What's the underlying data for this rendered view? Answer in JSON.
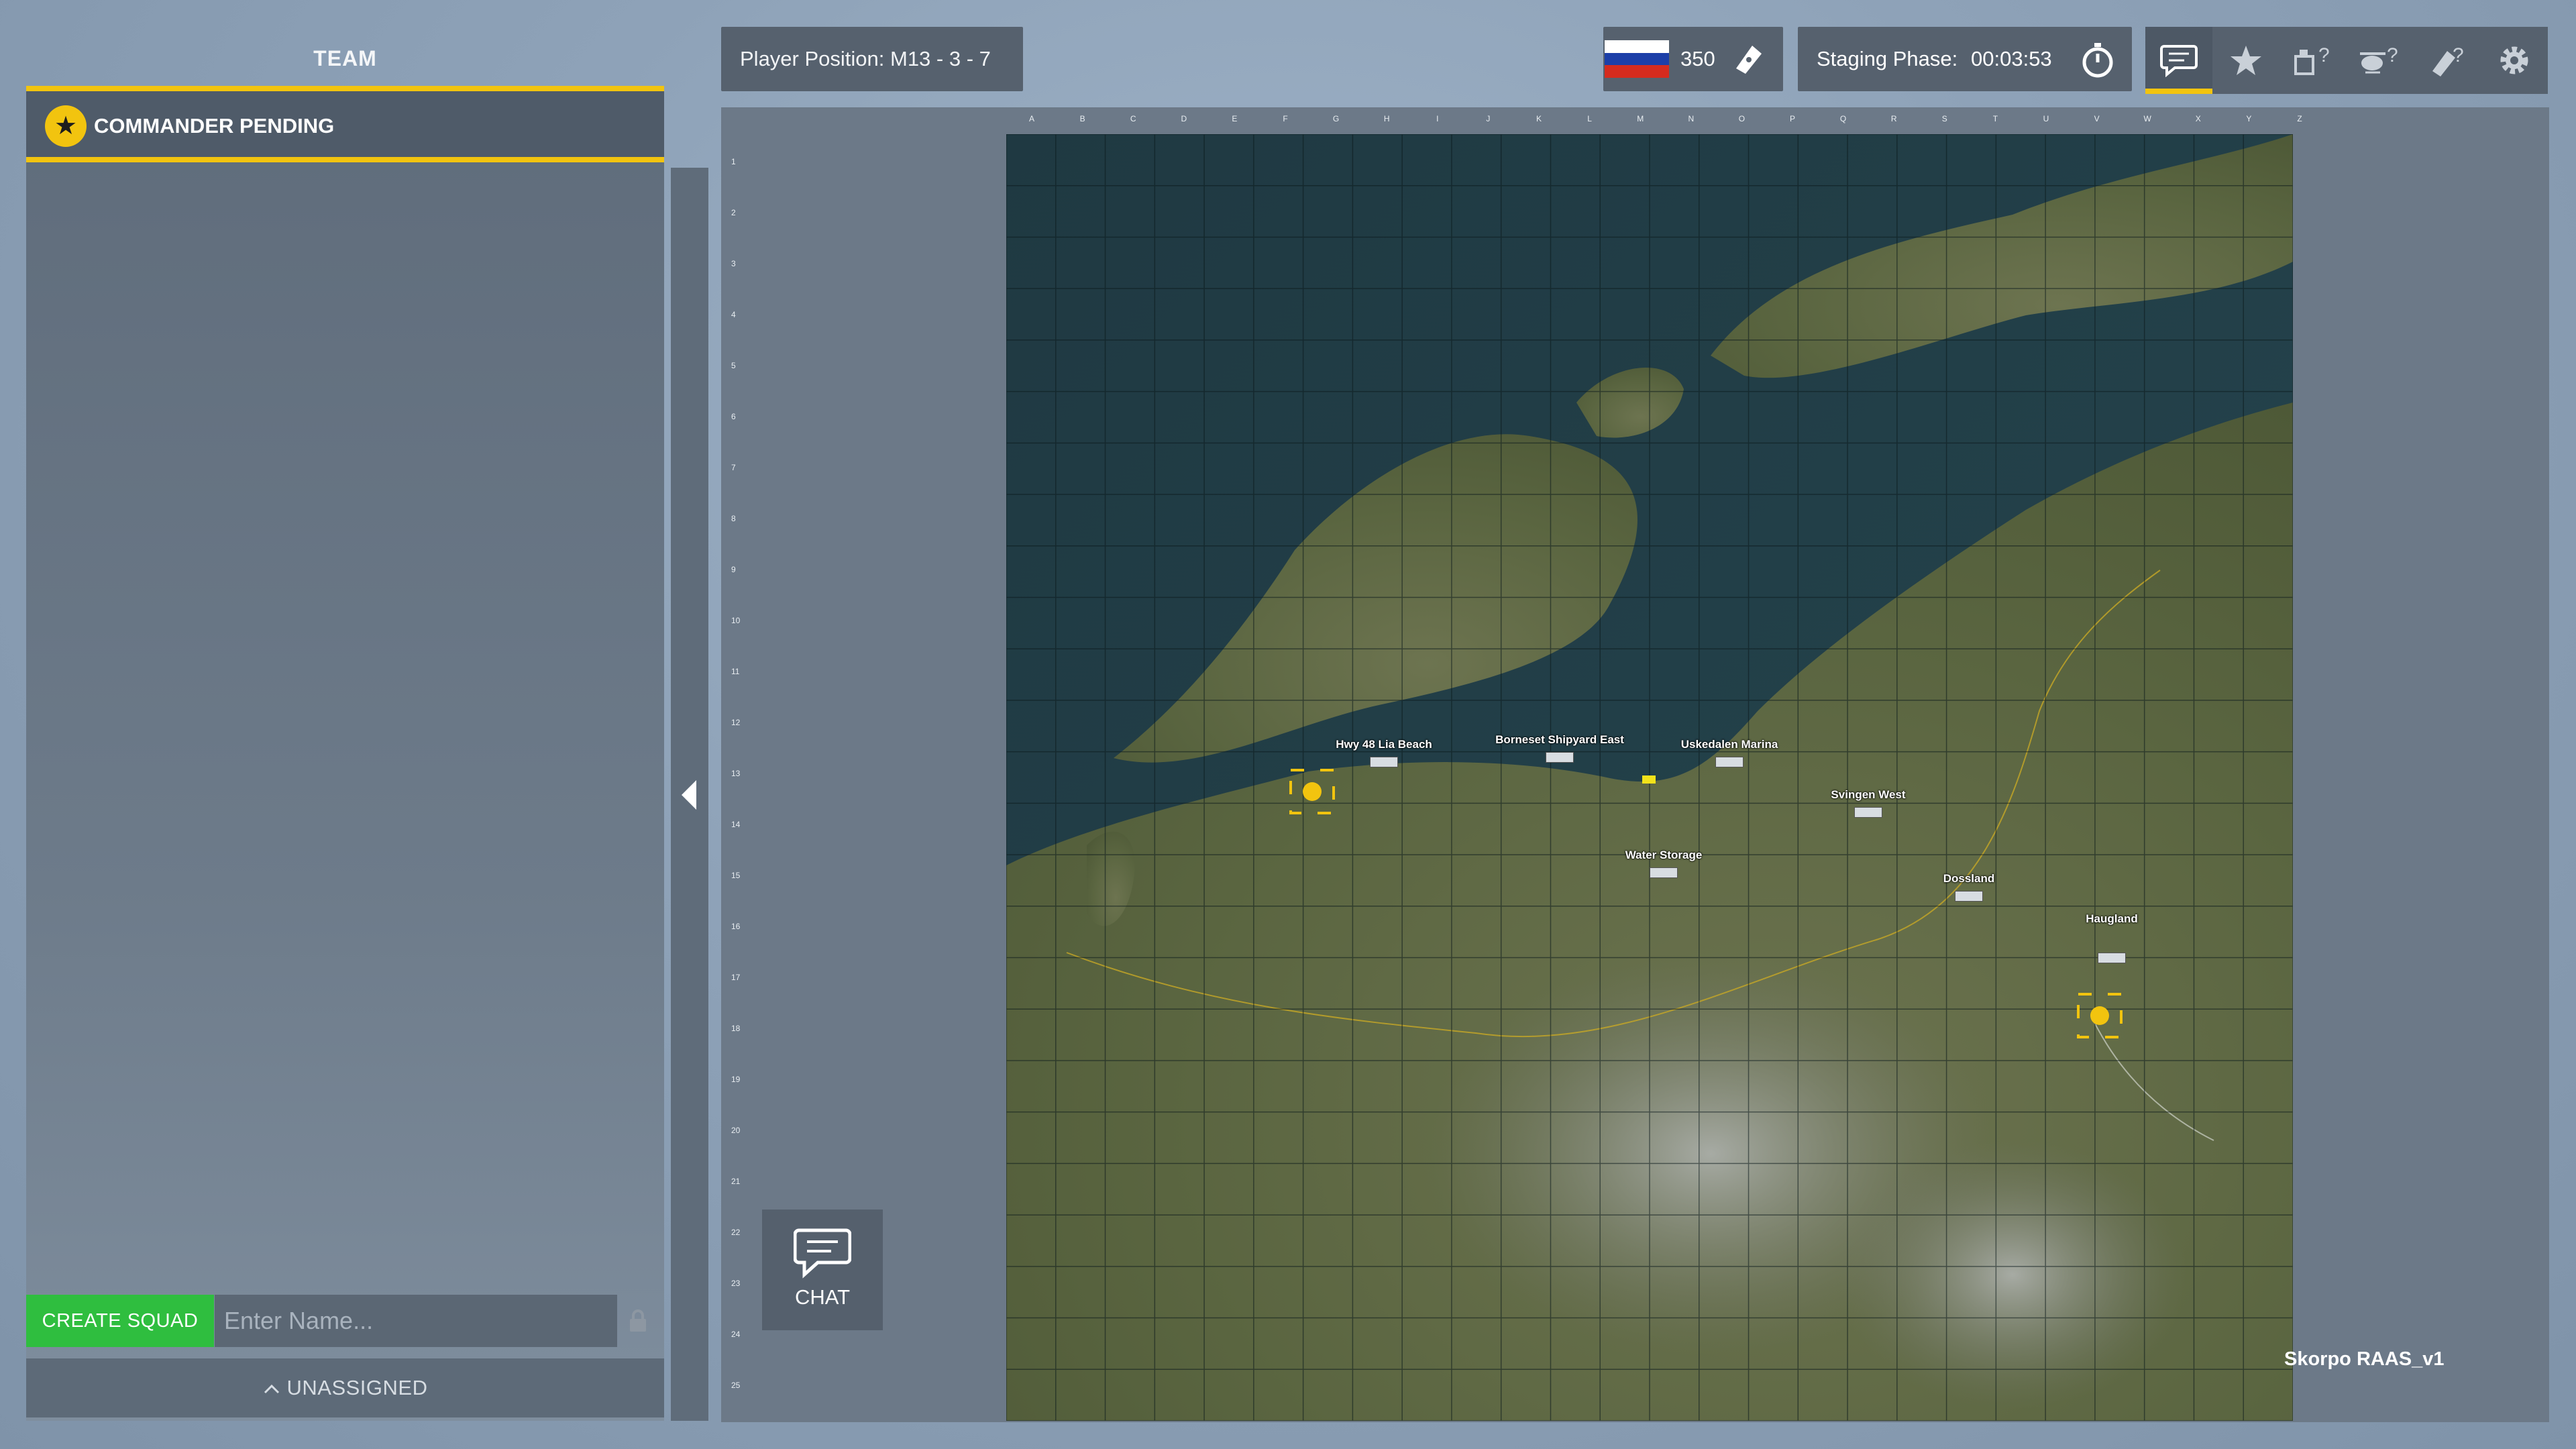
{
  "team_panel": {
    "title": "TEAM",
    "commander_label": "COMMANDER PENDING",
    "create_squad_label": "CREATE SQUAD",
    "squad_name_placeholder": "Enter Name...",
    "unassigned_label": "UNASSIGNED"
  },
  "top_bar": {
    "player_position": "Player Position: M13 - 3 - 7",
    "tickets": "350",
    "staging_label": "Staging Phase:",
    "staging_time": "00:03:53",
    "faction_flag": "russia-flag",
    "tools": [
      {
        "name": "chat-toggle-icon",
        "active": true
      },
      {
        "name": "star-icon",
        "active": false
      },
      {
        "name": "vehicle-help-icon",
        "active": false
      },
      {
        "name": "helicopter-help-icon",
        "active": false
      },
      {
        "name": "deploy-help-icon",
        "active": false
      },
      {
        "name": "settings-gear-icon",
        "active": false
      }
    ]
  },
  "map": {
    "name": "Skorpo RAAS_v1",
    "columns": [
      "A",
      "B",
      "C",
      "D",
      "E",
      "F",
      "G",
      "H",
      "I",
      "J",
      "K",
      "L",
      "M",
      "N",
      "O",
      "P",
      "Q",
      "R",
      "S",
      "T",
      "U",
      "V",
      "W",
      "X",
      "Y",
      "Z"
    ],
    "rows": [
      "1",
      "2",
      "3",
      "4",
      "5",
      "6",
      "7",
      "8",
      "9",
      "10",
      "11",
      "12",
      "13",
      "14",
      "15",
      "16",
      "17",
      "18",
      "19",
      "20",
      "21",
      "22",
      "23",
      "24",
      "25"
    ],
    "locations": [
      "Hwy 48 Lia Beach",
      "Borneset Shipyard East",
      "Uskedalen Marina",
      "Svingen West",
      "Water Storage",
      "Dossland",
      "Haugland"
    ]
  },
  "chat": {
    "label": "CHAT"
  },
  "colors": {
    "accent": "#f2c40f",
    "create_squad": "#2fbe3f",
    "panel": "#5f6c7b"
  }
}
